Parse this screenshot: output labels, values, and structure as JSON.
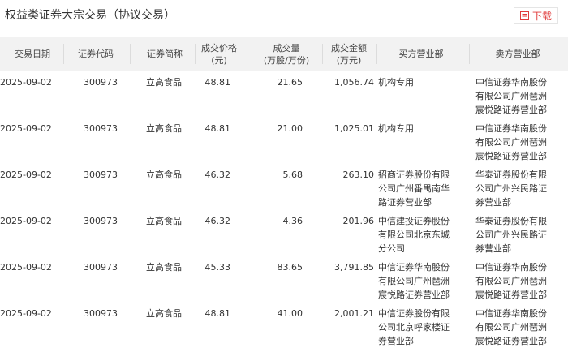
{
  "title": "权益类证券大宗交易（协议交易）",
  "download": {
    "label": "下载"
  },
  "columns": [
    "交易日期",
    "证券代码",
    "证券简称",
    "成交价格\n(元)",
    "成交量\n(万股/万份)",
    "成交金额\n(万元)",
    "买方营业部",
    "卖方营业部"
  ],
  "rows": [
    {
      "date": "2025-09-02",
      "code": "300973",
      "name": "立高食品",
      "price": "48.81",
      "volume": "21.65",
      "amount": "1,056.74",
      "buyer": [
        "机构专用"
      ],
      "seller": [
        "中信证券华南股份",
        "有限公司广州琶洲",
        "宸悦路证券营业部"
      ]
    },
    {
      "date": "2025-09-02",
      "code": "300973",
      "name": "立高食品",
      "price": "48.81",
      "volume": "21.00",
      "amount": "1,025.01",
      "buyer": [
        "机构专用"
      ],
      "seller": [
        "中信证券华南股份",
        "有限公司广州琶洲",
        "宸悦路证券营业部"
      ]
    },
    {
      "date": "2025-09-02",
      "code": "300973",
      "name": "立高食品",
      "price": "46.32",
      "volume": "5.68",
      "amount": "263.10",
      "buyer": [
        "招商证券股份有限",
        "公司广州番禺南华",
        "路证券营业部"
      ],
      "seller": [
        "华泰证券股份有限",
        "公司广州兴民路证",
        "券营业部"
      ]
    },
    {
      "date": "2025-09-02",
      "code": "300973",
      "name": "立高食品",
      "price": "46.32",
      "volume": "4.36",
      "amount": "201.96",
      "buyer": [
        "中信建投证券股份",
        "有限公司北京东城",
        "分公司"
      ],
      "seller": [
        "华泰证券股份有限",
        "公司广州兴民路证",
        "券营业部"
      ]
    },
    {
      "date": "2025-09-02",
      "code": "300973",
      "name": "立高食品",
      "price": "45.33",
      "volume": "83.65",
      "amount": "3,791.85",
      "buyer": [
        "中信证券华南股份",
        "有限公司广州琶洲",
        "宸悦路证券营业部"
      ],
      "seller": [
        "中信证券华南股份",
        "有限公司广州琶洲",
        "宸悦路证券营业部"
      ]
    },
    {
      "date": "2025-09-02",
      "code": "300973",
      "name": "立高食品",
      "price": "48.81",
      "volume": "41.00",
      "amount": "2,001.21",
      "buyer": [
        "中信证券股份有限",
        "公司北京呼家楼证",
        "券营业部"
      ],
      "seller": [
        "中信证券华南股份",
        "有限公司广州琶洲",
        "宸悦路证券营业部"
      ]
    }
  ]
}
